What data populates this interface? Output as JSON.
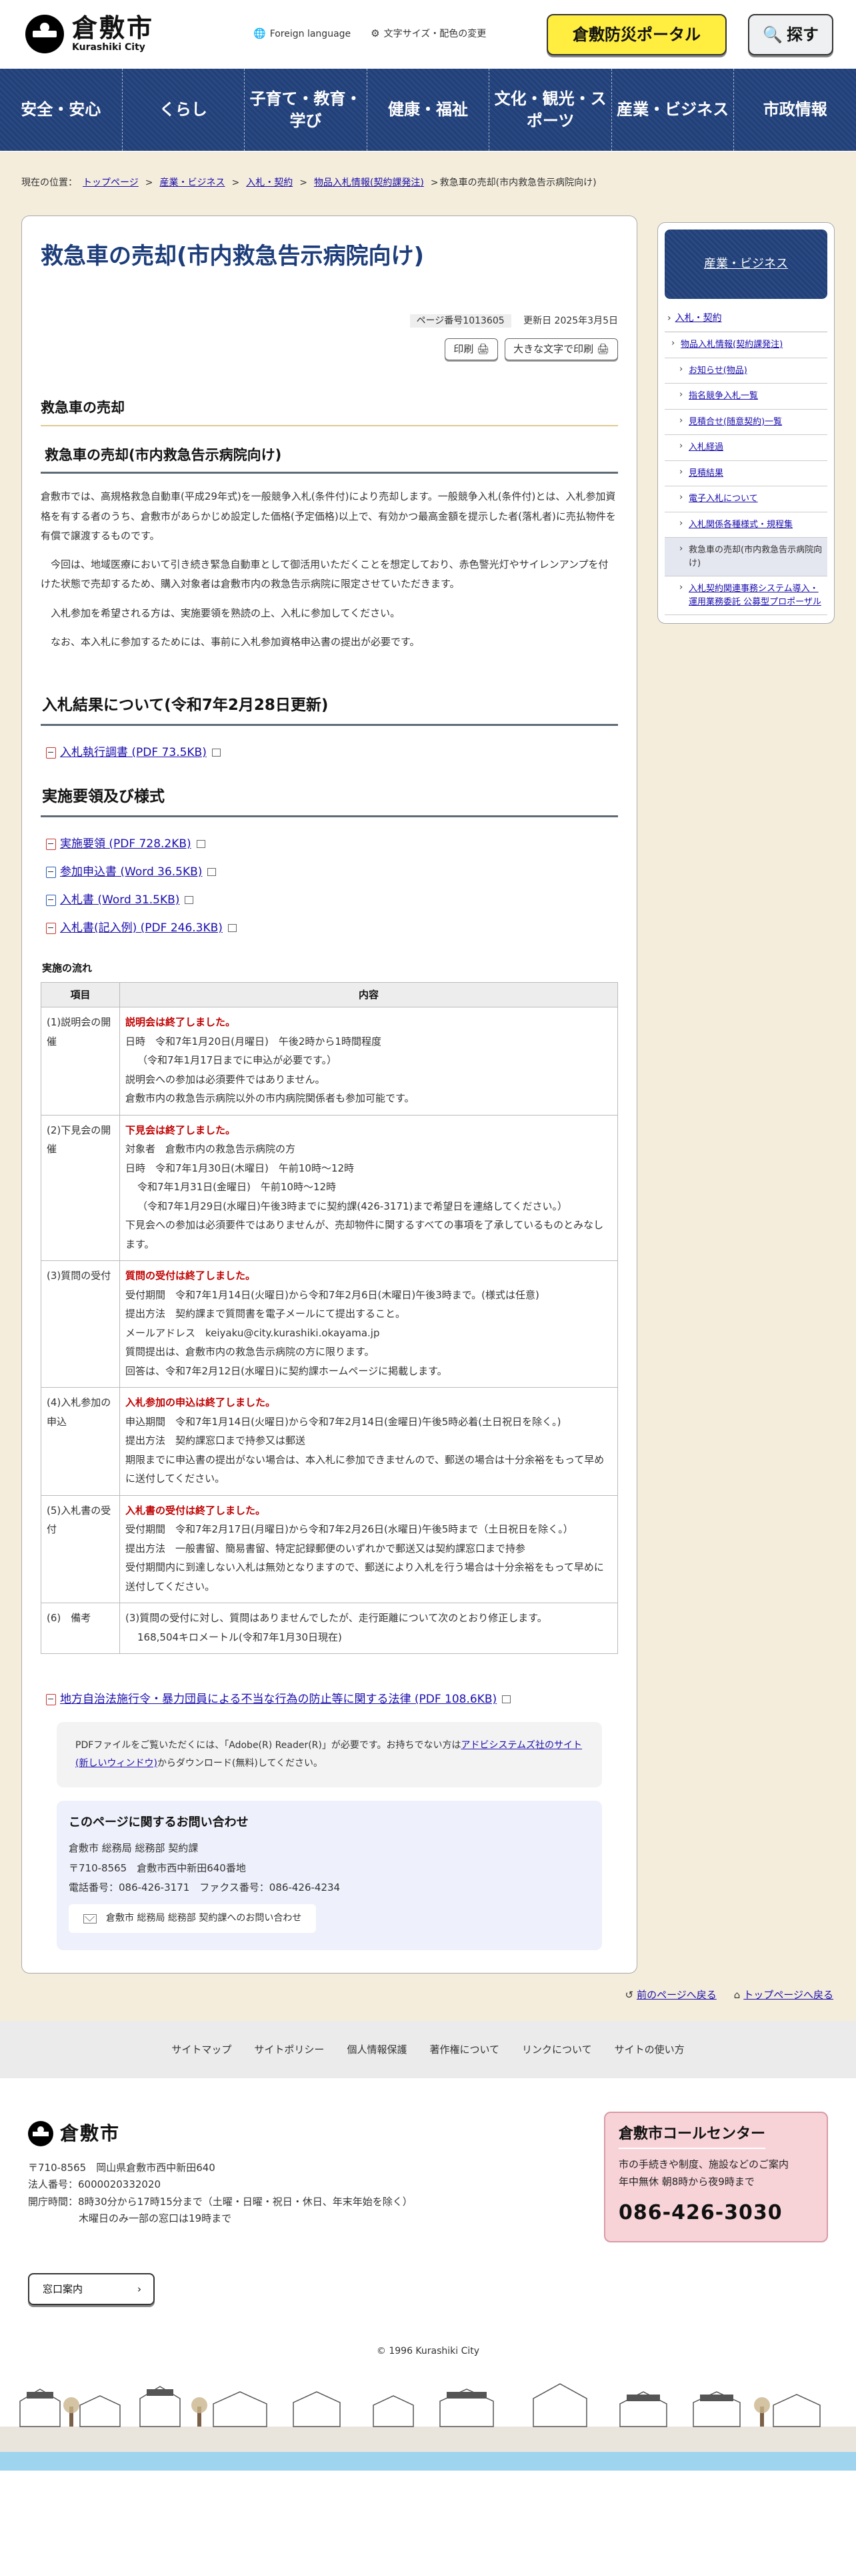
{
  "header": {
    "logo_ja": "倉敷市",
    "logo_en": "Kurashiki City",
    "foreign_language": "Foreign language",
    "text_size_color": "文字サイズ・配色の変更",
    "portal_button": "倉敷防災ポータル",
    "search_button": "探す"
  },
  "nav": [
    "安全・安心",
    "くらし",
    "子育て・教育・\n学び",
    "健康・福祉",
    "文化・観光・ス\nポーツ",
    "産業・ビジネス",
    "市政情報"
  ],
  "breadcrumb": {
    "prefix": "現在の位置：",
    "items": [
      "トップページ",
      "産業・ビジネス",
      "入札・契約",
      "物品入札情報(契約課発注)"
    ],
    "current": "救急車の売却(市内救急告示病院向け)"
  },
  "main": {
    "title": "救急車の売却(市内救急告示病院向け)",
    "page_number": "ページ番号1013605",
    "updated": "更新日 2025年3月5日",
    "print_label": "印刷",
    "print_large_label": "大きな文字で印刷",
    "h2": "救急車の売却",
    "h3": "救急車の売却(市内救急告示病院向け)",
    "paragraphs": [
      "倉敷市では、高規格救急自動車(平成29年式)を一般競争入札(条件付)により売却します。一般競争入札(条件付)とは、入札参加資格を有する者のうち、倉敷市があらかじめ設定した価格(予定価格)以上で、有効かつ最高金額を提示した者(落札者)に売払物件を有償で譲渡するものです。",
      "今回は、地域医療において引き続き緊急自動車として御活用いただくことを想定しており、赤色警光灯やサイレンアンプを付けた状態で売却するため、購入対象者は倉敷市内の救急告示病院に限定させていただきます。",
      "入札参加を希望される方は、実施要領を熟読の上、入札に参加してください。",
      "なお、本入札に参加するためには、事前に入札参加資格申込書の提出が必要です。"
    ],
    "result_heading": "入札結果について(令和7年2月28日更新)",
    "result_files": [
      {
        "label": "入札執行調書 (PDF 73.5KB)",
        "type": "pdf"
      }
    ],
    "guide_heading": "実施要領及び様式",
    "guide_files": [
      {
        "label": "実施要領 (PDF 728.2KB)",
        "type": "pdf"
      },
      {
        "label": "参加申込書 (Word 36.5KB)",
        "type": "word"
      },
      {
        "label": "入札書 (Word 31.5KB)",
        "type": "word"
      },
      {
        "label": "入札書(記入例) (PDF 246.3KB)",
        "type": "pdf"
      }
    ],
    "flow_caption": "実施の流れ",
    "table_headers": [
      "項目",
      "内容"
    ],
    "table_rows": [
      {
        "item": "(1)説明会の開催",
        "lines": [
          {
            "text": "説明会は終了しました。",
            "red": true
          },
          {
            "text": "日時　令和7年1月20日(月曜日)　午後2時から1時間程度"
          },
          {
            "text": "（令和7年1月17日までに申込が必要です。）",
            "indent": true
          },
          {
            "text": "説明会への参加は必須要件ではありません。"
          },
          {
            "text": "倉敷市内の救急告示病院以外の市内病院関係者も参加可能です。"
          }
        ]
      },
      {
        "item": "(2)下見会の開催",
        "lines": [
          {
            "text": "下見会は終了しました。",
            "red": true
          },
          {
            "text": "対象者　倉敷市内の救急告示病院の方"
          },
          {
            "text": "日時　令和7年1月30日(木曜日)　午前10時～12時"
          },
          {
            "text": "令和7年1月31日(金曜日)　午前10時～12時",
            "indent": true
          },
          {
            "text": "（令和7年1月29日(水曜日)午後3時までに契約課(426-3171)まで希望日を連絡してください。）",
            "indent": true
          },
          {
            "text": "下見会への参加は必須要件ではありませんが、売却物件に関するすべての事項を了承しているものとみなします。"
          }
        ]
      },
      {
        "item": "(3)質問の受付",
        "lines": [
          {
            "text": "質問の受付は終了しました。",
            "red": true
          },
          {
            "text": "受付期間　令和7年1月14日(火曜日)から令和7年2月6日(木曜日)午後3時まで。(様式は任意)"
          },
          {
            "text": "提出方法　契約課まで質問書を電子メールにて提出すること。"
          },
          {
            "text": "メールアドレス　keiyaku@city.kurashiki.okayama.jp"
          },
          {
            "text": "質問提出は、倉敷市内の救急告示病院の方に限ります。"
          },
          {
            "text": "回答は、令和7年2月12日(水曜日)に契約課ホームページに掲載します。"
          }
        ]
      },
      {
        "item": "(4)入札参加の申込",
        "lines": [
          {
            "text": "入札参加の申込は終了しました。",
            "red": true
          },
          {
            "text": "申込期間　令和7年1月14日(火曜日)から令和7年2月14日(金曜日)午後5時必着(土日祝日を除く。)"
          },
          {
            "text": "提出方法　契約課窓口まで持参又は郵送"
          },
          {
            "text": "期限までに申込書の提出がない場合は、本入札に参加できませんので、郵送の場合は十分余裕をもって早めに送付してください。"
          }
        ]
      },
      {
        "item": "(5)入札書の受付",
        "lines": [
          {
            "text": "入札書の受付は終了しました。",
            "red": true
          },
          {
            "text": "受付期間　令和7年2月17日(月曜日)から令和7年2月26日(水曜日)午後5時まで（土日祝日を除く。）"
          },
          {
            "text": "提出方法　一般書留、簡易書留、特定記録郵便のいずれかで郵送又は契約課窓口まで持参"
          },
          {
            "text": "受付期間内に到達しない入札は無効となりますので、郵送により入札を行う場合は十分余裕をもって早めに送付してください。"
          }
        ]
      },
      {
        "item": "(6)　備考",
        "lines": [
          {
            "text": "(3)質問の受付に対し、質問はありませんでしたが、走行距離について次のとおり修正します。"
          },
          {
            "text": "168,504キロメートル(令和7年1月30日現在)",
            "indent": true
          }
        ]
      }
    ],
    "law_link": "地方自治法施行令・暴力団員による不当な行為の防止等に関する法律 (PDF 108.6KB)",
    "pdf_note_before": "PDFファイルをご覧いただくには、「Adobe(R) Reader(R)」が必要です。お持ちでない方は",
    "pdf_note_link": "アドビシステムズ社のサイト(新しいウィンドウ)",
    "pdf_note_after": "からダウンロード(無料)してください。",
    "contact": {
      "title": "このページに関するお問い合わせ",
      "dept": "倉敷市 総務局 総務部 契約課",
      "postal": "〒710-8565　倉敷市西中新田640番地",
      "tel": "電話番号：086-426-3171　ファクス番号：086-426-4234",
      "form_button": "倉敷市 総務局 総務部 契約課へのお問い合わせ"
    }
  },
  "side": {
    "heading": "産業・ビジネス",
    "top_item": "入札・契約",
    "items": [
      {
        "label": "物品入札情報(契約課発注)",
        "link": true,
        "child": false
      },
      {
        "label": "お知らせ(物品)",
        "link": true,
        "child": true
      },
      {
        "label": "指名競争入札一覧",
        "link": true,
        "child": true
      },
      {
        "label": "見積合せ(随意契約)一覧",
        "link": true,
        "child": true
      },
      {
        "label": "入札経過",
        "link": true,
        "child": true
      },
      {
        "label": "見積結果",
        "link": true,
        "child": true
      },
      {
        "label": "電子入札について",
        "link": true,
        "child": true
      },
      {
        "label": "入札関係各種様式・規程集",
        "link": true,
        "child": true
      },
      {
        "label": "救急車の売却(市内救急告示病院向け)",
        "link": false,
        "child": true,
        "active": true
      },
      {
        "label": "入札契約関連事務システム導入・運用業務委託 公募型プロポーザル",
        "link": true,
        "child": true
      }
    ]
  },
  "page_links": {
    "back": "前のページへ戻る",
    "top": "トップページへ戻る"
  },
  "footer": {
    "links": [
      "サイトマップ",
      "サイトポリシー",
      "個人情報保護",
      "著作権について",
      "リンクについて",
      "サイトの使い方"
    ],
    "logo": "倉敷市",
    "address": "〒710-8565　岡山県倉敷市西中新田640",
    "corp_no": "法人番号：6000020332020",
    "hours": "開庁時間：8時30分から17時15分まで（土曜・日曜・祝日・休日、年末年始を除く）",
    "hours2": "木曜日のみ一部の窓口は19時まで",
    "window_button": "窓口案内",
    "callcenter_title": "倉敷市コールセンター",
    "callcenter_desc1": "市の手続きや制度、施設などのご案内",
    "callcenter_desc2": "年中無休 朝8時から夜9時まで",
    "callcenter_tel": "086-426-3030",
    "copyright": "© 1996 Kurashiki City"
  },
  "colors": {
    "nav_bg": "#22417a",
    "title": "#1d3d7a",
    "portal_yellow": "#ffed3f",
    "notice_red": "#c00000",
    "callcenter_pink": "#f7d3d8"
  }
}
